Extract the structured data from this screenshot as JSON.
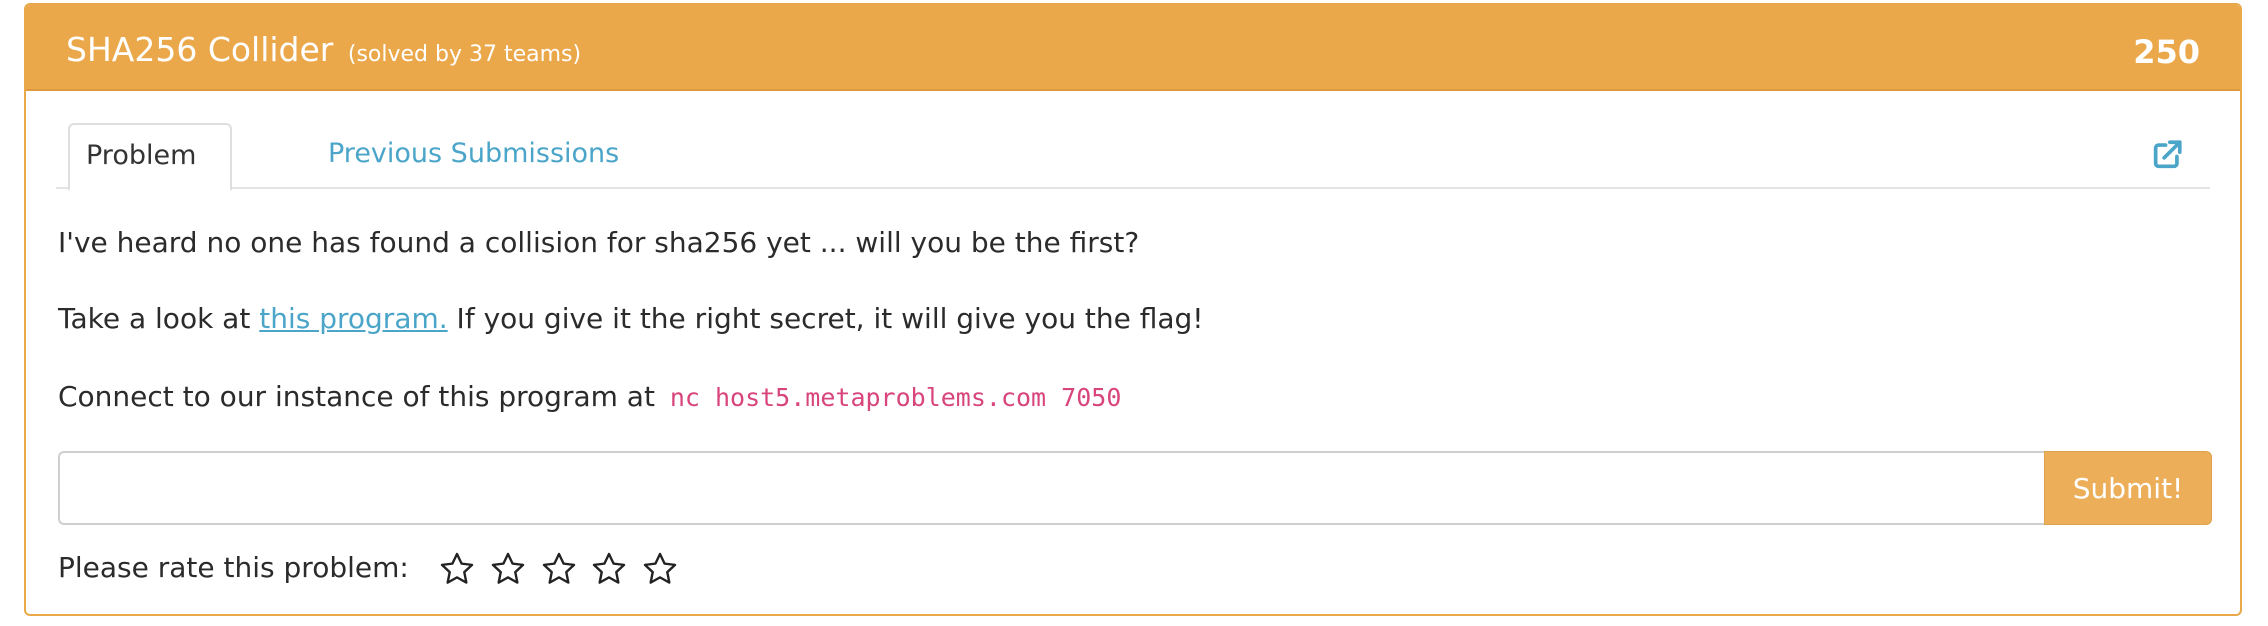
{
  "problem": {
    "title": "SHA256 Collider",
    "solved_text": "(solved by 37 teams)",
    "points": "250"
  },
  "tabs": [
    {
      "label": "Problem",
      "active": true
    },
    {
      "label": "Previous Submissions",
      "active": false
    }
  ],
  "description": {
    "p1": "I've heard no one has found a collision for sha256 yet ... will you be the first?",
    "p2_before": "Take a look at ",
    "p2_link": "this program.",
    "p2_after": " If you give it the right secret, it will give you the flag!",
    "p3_before": "Connect to our instance of this program at ",
    "p3_code": "nc host5.metaproblems.com 7050"
  },
  "flag_form": {
    "input_value": "",
    "submit_label": "Submit!"
  },
  "rating": {
    "label": "Please rate this problem:",
    "stars_max": 5,
    "stars_selected": 0
  },
  "icons": {
    "external_link": "external-link-icon",
    "star": "star-outline-icon"
  },
  "colors": {
    "heading_bg": "#eba84b",
    "link": "#4aa5c9",
    "code": "#d8457c"
  }
}
